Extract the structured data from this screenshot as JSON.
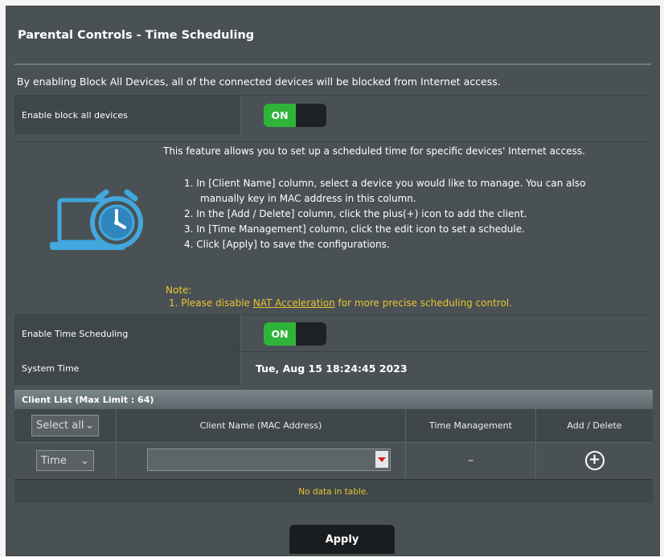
{
  "header": {
    "title": "Parental Controls - Time Scheduling"
  },
  "description": "By enabling Block All Devices, all of the connected devices will be blocked from Internet access.",
  "block_all": {
    "label": "Enable block all devices",
    "toggle": "ON"
  },
  "info": {
    "intro": "This feature allows you to set up a scheduled time for specific devices' Internet access.",
    "step1a": "1. In [Client Name] column, select a device you would like to manage. You can also",
    "step1b": "manually key in MAC address in this column.",
    "step2": "2. In the [Add / Delete] column, click the plus(+) icon to add the client.",
    "step3": "3. In [Time Management] column, click the edit icon to set a schedule.",
    "step4": "4. Click [Apply] to save the configurations.",
    "note_title": "Note:",
    "note_prefix": "1. Please disable ",
    "note_link": "NAT Acceleration",
    "note_suffix": " for more precise scheduling control.",
    "icon": "alarm-clock-laptop-icon"
  },
  "time_scheduling": {
    "label": "Enable Time Scheduling",
    "toggle": "ON"
  },
  "system_time": {
    "label": "System Time",
    "value": "Tue, Aug 15 18:24:45 2023"
  },
  "client_list": {
    "title": "Client List (Max Limit : 64)",
    "select_all": "Select all",
    "col_client": "Client Name (MAC Address)",
    "col_time": "Time Management",
    "col_add": "Add / Delete",
    "row_select": "Time",
    "time_value": "–",
    "empty": "No data in table."
  },
  "apply_label": "Apply",
  "colors": {
    "accent_green": "#2fb43a",
    "note_yellow": "#e8c432",
    "panel": "#4a5154"
  }
}
